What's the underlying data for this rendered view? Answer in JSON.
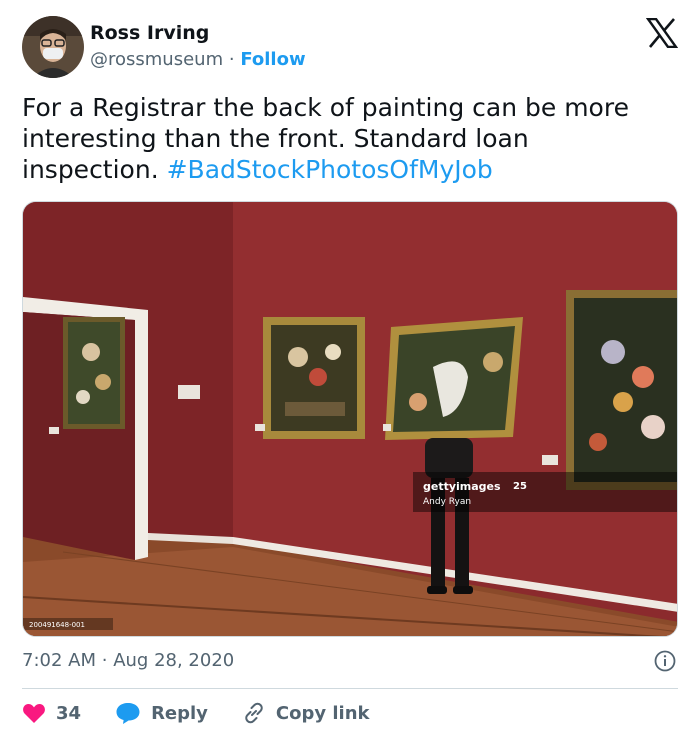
{
  "author": {
    "name": "Ross Irving",
    "handle": "@rossmuseum",
    "separator": "·",
    "follow_label": "Follow"
  },
  "tweet": {
    "text": "For a Registrar the back of painting can be more interesting than the front. Standard loan inspection.",
    "hashtag": "#BadStockPhotosOfMyJob",
    "time": "7:02 AM",
    "date_separator": "·",
    "date": "Aug 28, 2020"
  },
  "media": {
    "watermark_brand": "gettyimages",
    "watermark_badge": "25",
    "watermark_credit": "Andy Ryan",
    "image_id": "200491648-001"
  },
  "actions": {
    "like_count": "34",
    "reply_label": "Reply",
    "copy_label": "Copy link"
  },
  "colors": {
    "accent": "#1d9bf0",
    "like": "#f91880",
    "text": "#0f1419",
    "muted": "#536471",
    "wall": "#8d2a2c"
  },
  "icons": [
    "x-logo-icon",
    "info-icon",
    "heart-icon",
    "reply-bubble-icon",
    "link-icon"
  ]
}
